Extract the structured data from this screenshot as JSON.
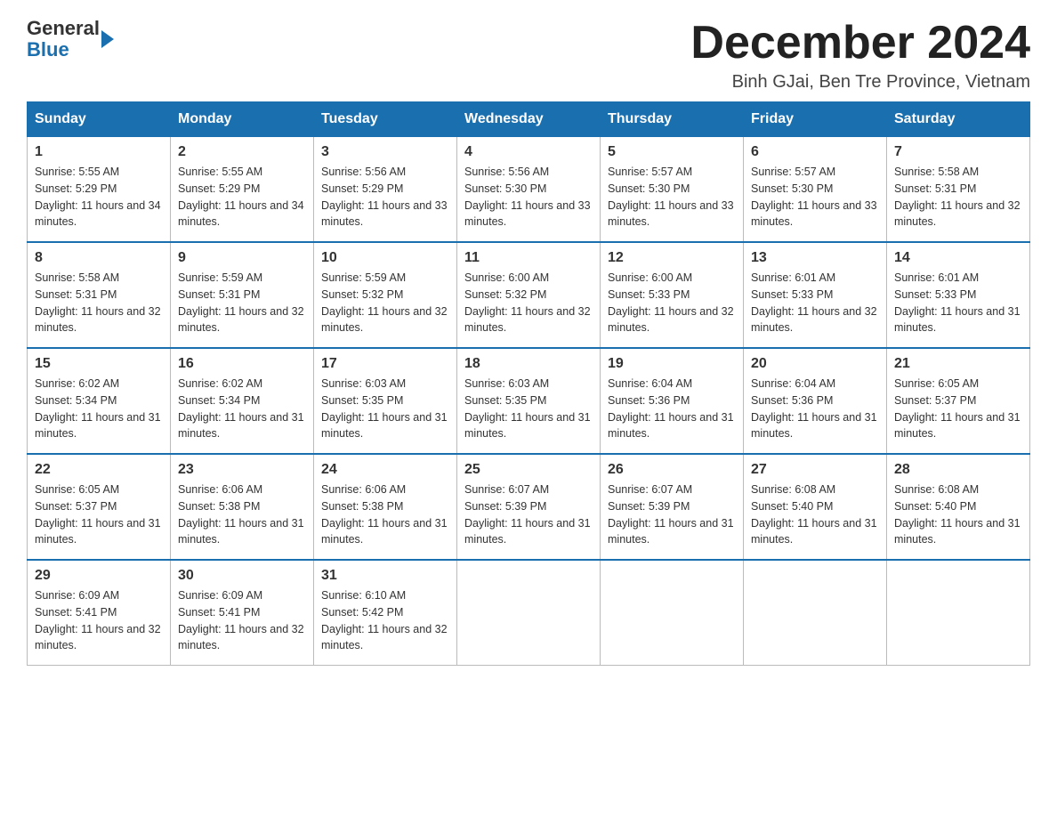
{
  "header": {
    "logo_general": "General",
    "logo_blue": "Blue",
    "month_year": "December 2024",
    "location": "Binh GJai, Ben Tre Province, Vietnam"
  },
  "days_of_week": [
    "Sunday",
    "Monday",
    "Tuesday",
    "Wednesday",
    "Thursday",
    "Friday",
    "Saturday"
  ],
  "weeks": [
    [
      {
        "day": "1",
        "sunrise": "5:55 AM",
        "sunset": "5:29 PM",
        "daylight": "11 hours and 34 minutes."
      },
      {
        "day": "2",
        "sunrise": "5:55 AM",
        "sunset": "5:29 PM",
        "daylight": "11 hours and 34 minutes."
      },
      {
        "day": "3",
        "sunrise": "5:56 AM",
        "sunset": "5:29 PM",
        "daylight": "11 hours and 33 minutes."
      },
      {
        "day": "4",
        "sunrise": "5:56 AM",
        "sunset": "5:30 PM",
        "daylight": "11 hours and 33 minutes."
      },
      {
        "day": "5",
        "sunrise": "5:57 AM",
        "sunset": "5:30 PM",
        "daylight": "11 hours and 33 minutes."
      },
      {
        "day": "6",
        "sunrise": "5:57 AM",
        "sunset": "5:30 PM",
        "daylight": "11 hours and 33 minutes."
      },
      {
        "day": "7",
        "sunrise": "5:58 AM",
        "sunset": "5:31 PM",
        "daylight": "11 hours and 32 minutes."
      }
    ],
    [
      {
        "day": "8",
        "sunrise": "5:58 AM",
        "sunset": "5:31 PM",
        "daylight": "11 hours and 32 minutes."
      },
      {
        "day": "9",
        "sunrise": "5:59 AM",
        "sunset": "5:31 PM",
        "daylight": "11 hours and 32 minutes."
      },
      {
        "day": "10",
        "sunrise": "5:59 AM",
        "sunset": "5:32 PM",
        "daylight": "11 hours and 32 minutes."
      },
      {
        "day": "11",
        "sunrise": "6:00 AM",
        "sunset": "5:32 PM",
        "daylight": "11 hours and 32 minutes."
      },
      {
        "day": "12",
        "sunrise": "6:00 AM",
        "sunset": "5:33 PM",
        "daylight": "11 hours and 32 minutes."
      },
      {
        "day": "13",
        "sunrise": "6:01 AM",
        "sunset": "5:33 PM",
        "daylight": "11 hours and 32 minutes."
      },
      {
        "day": "14",
        "sunrise": "6:01 AM",
        "sunset": "5:33 PM",
        "daylight": "11 hours and 31 minutes."
      }
    ],
    [
      {
        "day": "15",
        "sunrise": "6:02 AM",
        "sunset": "5:34 PM",
        "daylight": "11 hours and 31 minutes."
      },
      {
        "day": "16",
        "sunrise": "6:02 AM",
        "sunset": "5:34 PM",
        "daylight": "11 hours and 31 minutes."
      },
      {
        "day": "17",
        "sunrise": "6:03 AM",
        "sunset": "5:35 PM",
        "daylight": "11 hours and 31 minutes."
      },
      {
        "day": "18",
        "sunrise": "6:03 AM",
        "sunset": "5:35 PM",
        "daylight": "11 hours and 31 minutes."
      },
      {
        "day": "19",
        "sunrise": "6:04 AM",
        "sunset": "5:36 PM",
        "daylight": "11 hours and 31 minutes."
      },
      {
        "day": "20",
        "sunrise": "6:04 AM",
        "sunset": "5:36 PM",
        "daylight": "11 hours and 31 minutes."
      },
      {
        "day": "21",
        "sunrise": "6:05 AM",
        "sunset": "5:37 PM",
        "daylight": "11 hours and 31 minutes."
      }
    ],
    [
      {
        "day": "22",
        "sunrise": "6:05 AM",
        "sunset": "5:37 PM",
        "daylight": "11 hours and 31 minutes."
      },
      {
        "day": "23",
        "sunrise": "6:06 AM",
        "sunset": "5:38 PM",
        "daylight": "11 hours and 31 minutes."
      },
      {
        "day": "24",
        "sunrise": "6:06 AM",
        "sunset": "5:38 PM",
        "daylight": "11 hours and 31 minutes."
      },
      {
        "day": "25",
        "sunrise": "6:07 AM",
        "sunset": "5:39 PM",
        "daylight": "11 hours and 31 minutes."
      },
      {
        "day": "26",
        "sunrise": "6:07 AM",
        "sunset": "5:39 PM",
        "daylight": "11 hours and 31 minutes."
      },
      {
        "day": "27",
        "sunrise": "6:08 AM",
        "sunset": "5:40 PM",
        "daylight": "11 hours and 31 minutes."
      },
      {
        "day": "28",
        "sunrise": "6:08 AM",
        "sunset": "5:40 PM",
        "daylight": "11 hours and 31 minutes."
      }
    ],
    [
      {
        "day": "29",
        "sunrise": "6:09 AM",
        "sunset": "5:41 PM",
        "daylight": "11 hours and 32 minutes."
      },
      {
        "day": "30",
        "sunrise": "6:09 AM",
        "sunset": "5:41 PM",
        "daylight": "11 hours and 32 minutes."
      },
      {
        "day": "31",
        "sunrise": "6:10 AM",
        "sunset": "5:42 PM",
        "daylight": "11 hours and 32 minutes."
      },
      null,
      null,
      null,
      null
    ]
  ]
}
